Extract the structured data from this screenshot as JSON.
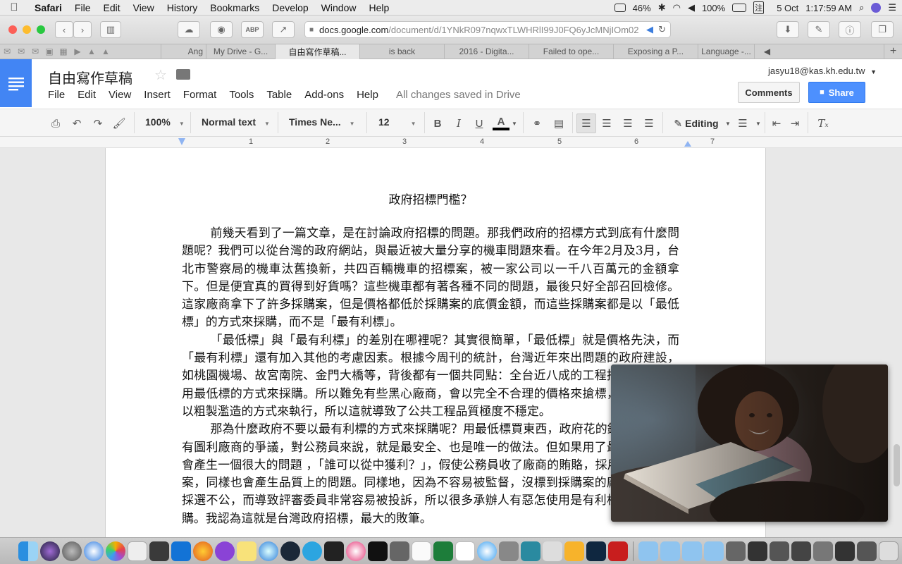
{
  "menubar": {
    "app": "Safari",
    "items": [
      "File",
      "Edit",
      "View",
      "History",
      "Bookmarks",
      "Develop",
      "Window",
      "Help"
    ],
    "battery_pct": "46%",
    "volume_pct": "100%",
    "date": "5 Oct",
    "time": "1:17:59 AM",
    "input_char": "注"
  },
  "safari": {
    "url_host": "docs.google.com",
    "url_path": "/document/d/1YNkR097nqwxTLWHRlI99J0FQ6yJcMNjIOm02"
  },
  "tabs": [
    {
      "label": "Ang",
      "active": false
    },
    {
      "label": "My Drive - G...",
      "active": false
    },
    {
      "label": "自由寫作草稿...",
      "active": true
    },
    {
      "label": "is back",
      "active": false
    },
    {
      "label": "2016 - Digita...",
      "active": false
    },
    {
      "label": "Failed to ope...",
      "active": false
    },
    {
      "label": "Exposing a P...",
      "active": false
    },
    {
      "label": "Language -...",
      "active": false
    }
  ],
  "docs": {
    "title": "自由寫作草稿",
    "menus": [
      "File",
      "Edit",
      "View",
      "Insert",
      "Format",
      "Tools",
      "Table",
      "Add-ons",
      "Help"
    ],
    "save_status": "All changes saved in Drive",
    "account": "jasyu18@kas.kh.edu.tw",
    "comments_label": "Comments",
    "share_label": "Share"
  },
  "toolbar": {
    "zoom": "100%",
    "style": "Normal text",
    "font": "Times Ne...",
    "size": "12",
    "mode": "Editing"
  },
  "ruler": [
    "1",
    "2",
    "3",
    "4",
    "5",
    "6",
    "7"
  ],
  "document": {
    "heading": "政府招標門檻？",
    "paragraphs": [
      "前幾天看到了一篇文章，是在討論政府招標的問題。那我們政府的招標方式到底有什麼問題呢？我們可以從台灣的政府網站，與最近被大量分享的機車問題來看。在今年2月及3月，台北市警察局的機車汰舊換新，共四百輛機車的招標案，被一家公司以一千八百萬元的金額拿下。但是便宜真的買得到好貨嗎？這些機車都有著各種不同的問題，最後只好全部召回檢修。這家廠商拿下了許多採購案，但是價格都低於採購案的底價金額，而這些採購案都是以「最低標」的方式來採購，而不是「最有利標」。",
      "「最低標」與「最有利標」的差別在哪裡呢？其實很簡單，「最低標」就是價格先決，而「最有利標」還有加入其他的考慮因素。根據今周刊的統計，台灣近年來出問題的政府建設，如桃園機場、故宮南院、金門大橋等，背後都有一個共同點：全台近八成的工程招標，都是採用最低標的方式來採購。所以難免有些黑心廠商，會以完全不合理的價格來搶標，搶到之後再以粗製濫造的方式來執行，所以這就導致了公共工程品質極度不穩定。",
      "那為什麼政府不要以最有利標的方式來採購呢？用最低標買東西，政府花的錢最少、也沒有圖利廠商的爭議，對公務員來說，就是最安全、也是唯一的做法。但如果用了最有利標，就會產生一個很大的問題 ，「誰可以從中獲利？」，假使公務員收了廠商的賄賂，採用了他們的標案，同樣也會產生品質上的問題。同樣地，因為不容易被監督，沒標到採購案的廠商也會認為採選不公，而導致評審委員非常容易被投訴，所以很多承辦人有惡怎使用是有利標的方式來採購。我認為這就是台灣政府招標，最大的敗筆。"
    ]
  },
  "colors": {
    "docs_blue": "#4285f4",
    "share_blue": "#4d90fe"
  }
}
